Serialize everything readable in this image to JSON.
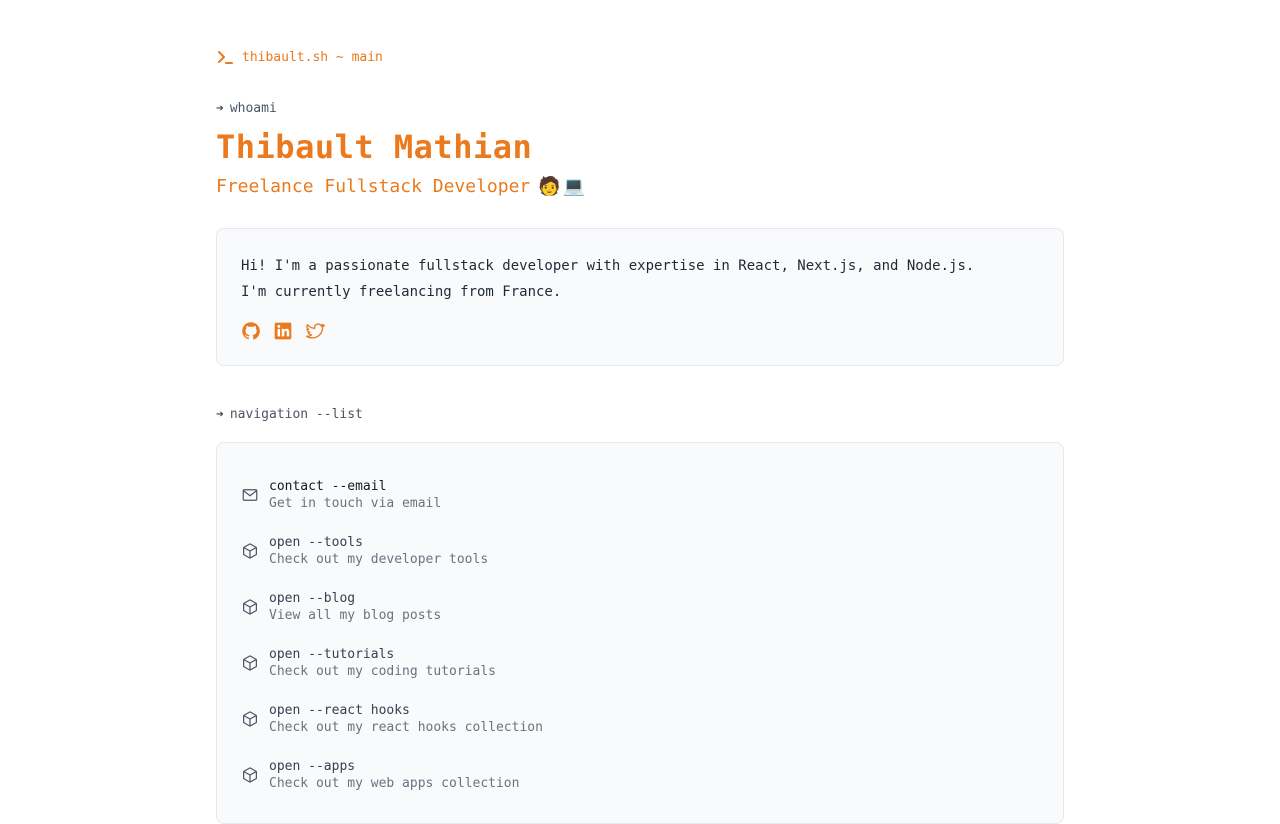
{
  "header": {
    "brand_label": "thibault.sh ~ main"
  },
  "whoami": {
    "prompt_arrow": "➔",
    "prompt_cmd": "whoami",
    "name": "Thibault Mathian",
    "role": "Freelance Fullstack Developer",
    "role_emojis": [
      "🧑",
      "💻"
    ]
  },
  "about": {
    "bio_line1": "Hi! I'm a passionate fullstack developer with expertise in React, Next.js, and Node.js.",
    "bio_line2": "I'm currently freelancing from France.",
    "socials": [
      {
        "icon": "github-icon"
      },
      {
        "icon": "linkedin-icon"
      },
      {
        "icon": "twitter-icon"
      }
    ]
  },
  "navigation": {
    "prompt_arrow": "➔",
    "prompt_cmd": "navigation --list",
    "items": [
      {
        "icon": "mail-icon",
        "cmd": "contact --email",
        "desc": "Get in touch via email"
      },
      {
        "icon": "box-icon",
        "cmd": "open --tools",
        "desc": "Check out my developer tools"
      },
      {
        "icon": "box-icon",
        "cmd": "open --blog",
        "desc": "View all my blog posts"
      },
      {
        "icon": "box-icon",
        "cmd": "open --tutorials",
        "desc": "Check out my coding tutorials"
      },
      {
        "icon": "box-icon",
        "cmd": "open --react hooks",
        "desc": "Check out my react hooks collection"
      },
      {
        "icon": "box-icon",
        "cmd": "open --apps",
        "desc": "Check out my web apps collection"
      }
    ]
  },
  "colors": {
    "accent": "#ea7a1d",
    "card_bg": "#f9fafb",
    "card_border": "#e5e7eb"
  }
}
